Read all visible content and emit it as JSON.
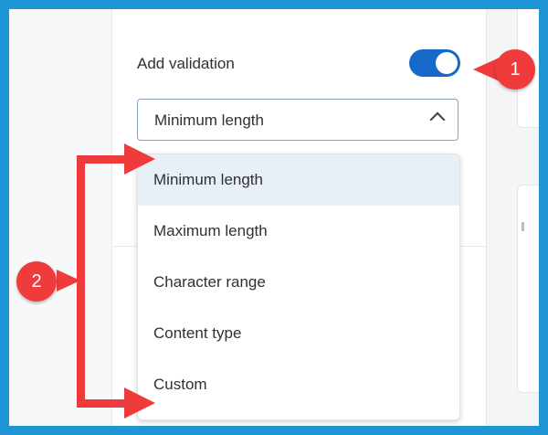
{
  "validation": {
    "label": "Add validation",
    "toggle_on": true,
    "accent_color": "#1668c9"
  },
  "select": {
    "value": "Minimum length",
    "icon": "chevron-up-icon"
  },
  "menu": {
    "options": [
      {
        "label": "Minimum length",
        "selected": true
      },
      {
        "label": "Maximum length",
        "selected": false
      },
      {
        "label": "Character range",
        "selected": false
      },
      {
        "label": "Content type",
        "selected": false
      },
      {
        "label": "Custom",
        "selected": false
      }
    ]
  },
  "annotations": {
    "callout_1": "1",
    "callout_2": "2",
    "callout_color": "#ef3b3b",
    "border_color": "#1e95d4"
  }
}
